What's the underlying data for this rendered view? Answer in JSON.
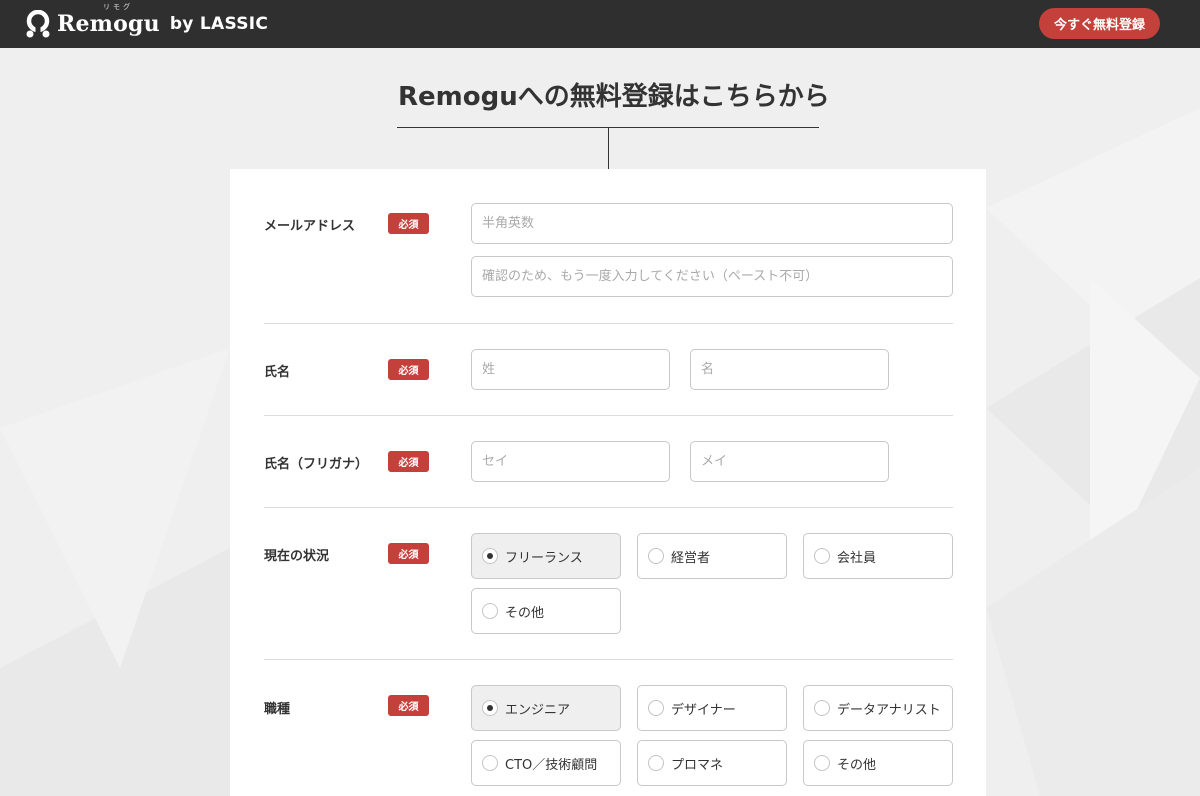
{
  "header": {
    "logo_text": "Remogu",
    "logo_ruby": "リモグ",
    "logo_by": "by LASSIC",
    "cta_label": "今すぐ無料登録"
  },
  "page_title": "Remoguへの無料登録はこちらから",
  "form": {
    "required_badge": "必須",
    "email": {
      "label": "メールアドレス",
      "placeholder": "半角英数",
      "confirm_placeholder": "確認のため、もう一度入力してください（ペースト不可）"
    },
    "name": {
      "label": "氏名",
      "last_placeholder": "姓",
      "first_placeholder": "名"
    },
    "name_kana": {
      "label": "氏名（フリガナ）",
      "last_placeholder": "セイ",
      "first_placeholder": "メイ"
    },
    "status": {
      "label": "現在の状況",
      "options": [
        "フリーランス",
        "経営者",
        "会社員",
        "その他"
      ],
      "selected": "フリーランス"
    },
    "occupation": {
      "label": "職種",
      "options": [
        "エンジニア",
        "デザイナー",
        "データアナリスト",
        "CTO／技術顧問",
        "プロマネ",
        "その他"
      ],
      "selected": "エンジニア"
    }
  },
  "colors": {
    "accent": "#c4403b",
    "header_bg": "#2f2f2f",
    "page_bg": "#efefef"
  }
}
